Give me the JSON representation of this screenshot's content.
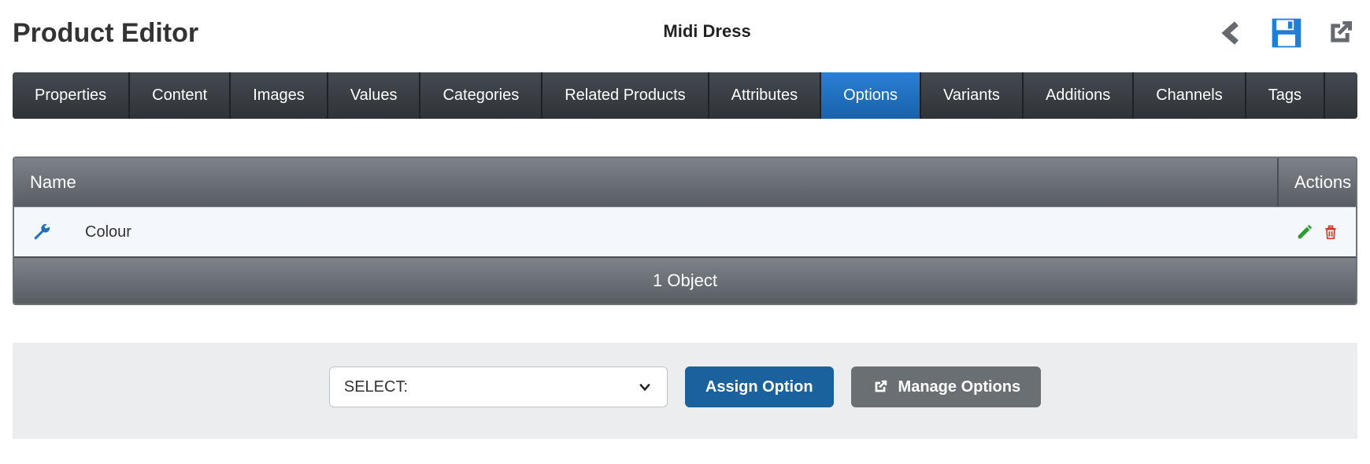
{
  "header": {
    "title": "Product Editor",
    "product_name": "Midi Dress"
  },
  "tabs": [
    {
      "label": "Properties",
      "active": false
    },
    {
      "label": "Content",
      "active": false
    },
    {
      "label": "Images",
      "active": false
    },
    {
      "label": "Values",
      "active": false
    },
    {
      "label": "Categories",
      "active": false
    },
    {
      "label": "Related Products",
      "active": false
    },
    {
      "label": "Attributes",
      "active": false
    },
    {
      "label": "Options",
      "active": true
    },
    {
      "label": "Variants",
      "active": false
    },
    {
      "label": "Additions",
      "active": false
    },
    {
      "label": "Channels",
      "active": false
    },
    {
      "label": "Tags",
      "active": false
    }
  ],
  "table": {
    "columns": {
      "name": "Name",
      "actions": "Actions"
    },
    "rows": [
      {
        "icon": "wrench-icon",
        "name": "Colour"
      }
    ],
    "footer": "1 Object"
  },
  "footer": {
    "select_placeholder": "SELECT:",
    "assign_label": "Assign Option",
    "manage_label": "Manage Options"
  },
  "colors": {
    "tab_active": "#1d6fbf",
    "primary": "#1a629e",
    "secondary": "#6a6f74",
    "edit_icon": "#2e9e2e",
    "delete_icon": "#d33a2a",
    "wrench_icon": "#1d6fbf",
    "save_icon": "#1d7fd8",
    "nav_icon": "#666a6e"
  }
}
